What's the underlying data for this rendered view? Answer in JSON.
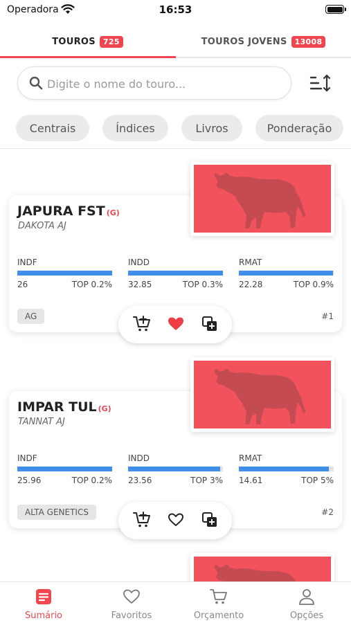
{
  "status_bar": {
    "carrier": "Operadora",
    "time": "16:53"
  },
  "tabs": [
    {
      "label": "TOUROS",
      "badge": "725",
      "active": true
    },
    {
      "label": "TOUROS JOVENS",
      "badge": "13008",
      "active": false
    }
  ],
  "search": {
    "placeholder": "Digite o nome do touro..."
  },
  "filters": [
    "Centrais",
    "Índices",
    "Livros",
    "Ponderação"
  ],
  "bulls": [
    {
      "name": "JAPURA FST",
      "marker": "(G)",
      "sire": "DAKOTA AJ",
      "stats": [
        {
          "label": "INDF",
          "value": "26",
          "top": "TOP 0.2%",
          "fill": 0.998
        },
        {
          "label": "INDD",
          "value": "32.85",
          "top": "TOP 0.3%",
          "fill": 0.997
        },
        {
          "label": "RMAT",
          "value": "22.28",
          "top": "TOP 0.9%",
          "fill": 0.991
        }
      ],
      "center": "AG",
      "rank": "#1",
      "favorite": true
    },
    {
      "name": "IMPAR TUL",
      "marker": "(G)",
      "sire": "TANNAT AJ",
      "stats": [
        {
          "label": "INDF",
          "value": "25.96",
          "top": "TOP 0.2%",
          "fill": 0.998
        },
        {
          "label": "INDD",
          "value": "23.56",
          "top": "TOP 3%",
          "fill": 0.97
        },
        {
          "label": "RMAT",
          "value": "14.61",
          "top": "TOP 5%",
          "fill": 0.95
        }
      ],
      "center": "ALTA GENETICS",
      "rank": "#2",
      "favorite": false
    }
  ],
  "bottom_nav": [
    {
      "label": "Sumário",
      "icon": "summary-icon",
      "active": true
    },
    {
      "label": "Favoritos",
      "icon": "heart-icon",
      "active": false
    },
    {
      "label": "Orçamento",
      "icon": "cart-icon",
      "active": false
    },
    {
      "label": "Opções",
      "icon": "user-icon",
      "active": false
    }
  ],
  "colors": {
    "accent": "#ef4650",
    "bar": "#3d8ee8",
    "photo_placeholder": "#f2525c"
  }
}
